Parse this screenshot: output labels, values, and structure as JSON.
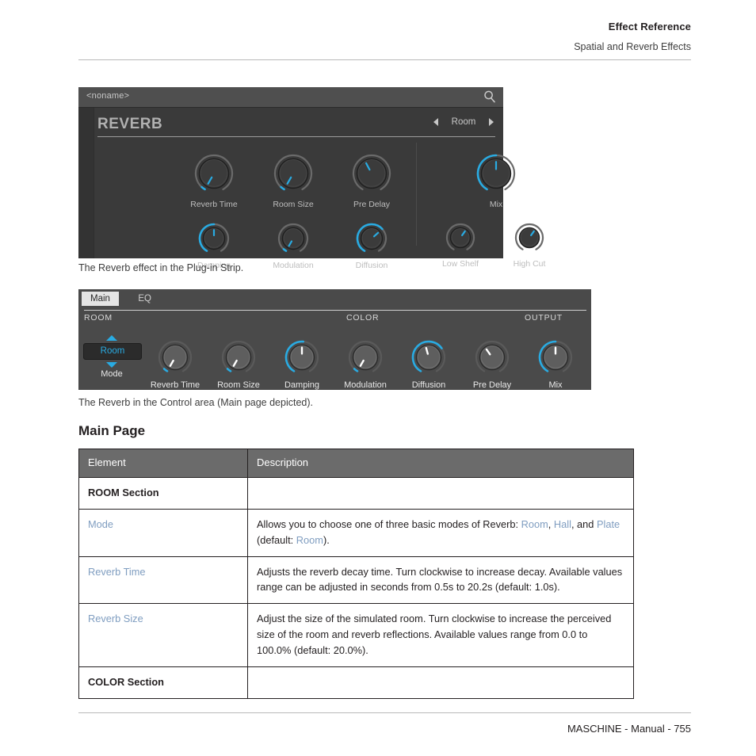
{
  "header": {
    "title": "Effect Reference",
    "subtitle": "Spatial and Reverb Effects"
  },
  "plugin_strip": {
    "preset_name": "<noname>",
    "search_icon": "magnifier-icon",
    "effect_title": "REVERB",
    "preset_selector": {
      "prev_icon": "triangle-left-icon",
      "value": "Room",
      "next_icon": "triangle-right-icon"
    },
    "knobs_row1": [
      {
        "label": "Reverb Time",
        "angle": -150,
        "arc": 12,
        "size": 50
      },
      {
        "label": "Room Size",
        "angle": -150,
        "arc": 12,
        "size": 50
      },
      {
        "label": "Pre Delay",
        "angle": -28,
        "arc": 0,
        "size": 50
      },
      {
        "label": "Mix",
        "angle": 0,
        "arc": 150,
        "size": 50
      }
    ],
    "knobs_row2": [
      {
        "label": "Damping",
        "angle": 0,
        "arc": 150,
        "size": 40
      },
      {
        "label": "Modulation",
        "angle": -150,
        "arc": 12,
        "size": 40
      },
      {
        "label": "Diffusion",
        "angle": 48,
        "arc": 198,
        "size": 40
      },
      {
        "label": "Low Shelf",
        "angle": 35,
        "arc": 0,
        "size": 38
      },
      {
        "label": "High Cut",
        "angle": 35,
        "arc": 0,
        "size": 38
      }
    ]
  },
  "caption_1": "The Reverb effect in the Plug-in Strip.",
  "control_area": {
    "tabs": [
      {
        "label": "Main",
        "active": true
      },
      {
        "label": "EQ",
        "active": false
      }
    ],
    "sections": [
      {
        "label": "ROOM"
      },
      {
        "label": "COLOR"
      },
      {
        "label": "OUTPUT"
      }
    ],
    "mode": {
      "label": "Mode",
      "value": "Room",
      "up_icon": "triangle-up-icon",
      "down_icon": "triangle-down-icon"
    },
    "knobs": [
      {
        "label": "Reverb Time",
        "angle": -150,
        "arc": 14
      },
      {
        "label": "Room Size",
        "angle": -150,
        "arc": 14
      },
      {
        "label": "Damping",
        "angle": 0,
        "arc": 155
      },
      {
        "label": "Modulation",
        "angle": -150,
        "arc": 14
      },
      {
        "label": "Diffusion",
        "angle": -15,
        "arc": 205
      },
      {
        "label": "Pre Delay",
        "angle": -35,
        "arc": 0
      },
      {
        "label": "Mix",
        "angle": 0,
        "arc": 150
      }
    ]
  },
  "caption_2": "The Reverb in the Control area (Main page depicted).",
  "section_heading": "Main Page",
  "table": {
    "columns": [
      "Element",
      "Description"
    ],
    "rows": [
      {
        "type": "section",
        "element": "ROOM Section",
        "description": ""
      },
      {
        "type": "param",
        "element": "Mode",
        "desc_parts": [
          {
            "t": "Allows you to choose one of three basic modes of Reverb: ",
            "link": false
          },
          {
            "t": "Room",
            "link": true
          },
          {
            "t": ", ",
            "link": false
          },
          {
            "t": "Hall",
            "link": true
          },
          {
            "t": ", and ",
            "link": false
          },
          {
            "t": "Plate",
            "link": true
          },
          {
            "t": " (default: ",
            "link": false
          },
          {
            "t": "Room",
            "link": true
          },
          {
            "t": ").",
            "link": false
          }
        ]
      },
      {
        "type": "param",
        "element": "Reverb Time",
        "desc_parts": [
          {
            "t": "Adjusts the reverb decay time. Turn clockwise to increase decay. Available values range can be adjusted in seconds from 0.5s to 20.2s (default: 1.0s).",
            "link": false
          }
        ]
      },
      {
        "type": "param",
        "element": "Reverb Size",
        "desc_parts": [
          {
            "t": "Adjust the size of the simulated room. Turn clockwise to increase the perceived size of the room and reverb reflections. Available values range from 0.0 to 100.0% (default: 20.0%).",
            "link": false
          }
        ]
      },
      {
        "type": "section",
        "element": "COLOR Section",
        "description": ""
      }
    ]
  },
  "footer": {
    "text": "MASCHINE - Manual - 755"
  },
  "colors": {
    "accent": "#29ABE2",
    "link": "#7f9dc0",
    "table_header_bg": "#6b6b6b"
  }
}
